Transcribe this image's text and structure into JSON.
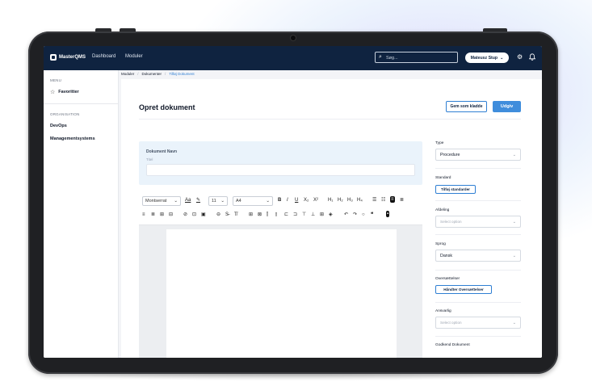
{
  "nav": {
    "logo": "MasterQMS",
    "dashboard": "Dashboard",
    "moduler": "Moduler",
    "search_placeholder": "Søg...",
    "user": "Mateusz Stup"
  },
  "sidebar": {
    "menu_label": "MENU",
    "favoritter": "Favoritter",
    "org_label": "ORGANISATION",
    "items": [
      "DevOps",
      "Managementsystems"
    ]
  },
  "breadcrumb": [
    "Moduler",
    "Dokumenter",
    "Tilføj Dokument"
  ],
  "page": {
    "title": "Opret dokument",
    "save_draft": "Gem som kladde",
    "publish": "Udgiv"
  },
  "doc_name": {
    "label": "Dokument Navn",
    "sublabel": "Titel"
  },
  "editor": {
    "font": "Montserrat",
    "size": "11",
    "paper": "A4"
  },
  "panel": {
    "type_label": "Type",
    "type_value": "Procedure",
    "standard_label": "Standard",
    "standard_btn": "Tilføj standarder",
    "afdeling_label": "Afdeling",
    "afdeling_placeholder": "Select option",
    "sprog_label": "Sprog",
    "sprog_value": "Dansk",
    "oversaet_label": "Oversættelser",
    "oversaet_btn": "Håndter Oversættelser",
    "ansvarlig_label": "Ansvarlig",
    "ansvarlig_placeholder": "Select option",
    "godkend_label": "Godkend Dokument"
  }
}
